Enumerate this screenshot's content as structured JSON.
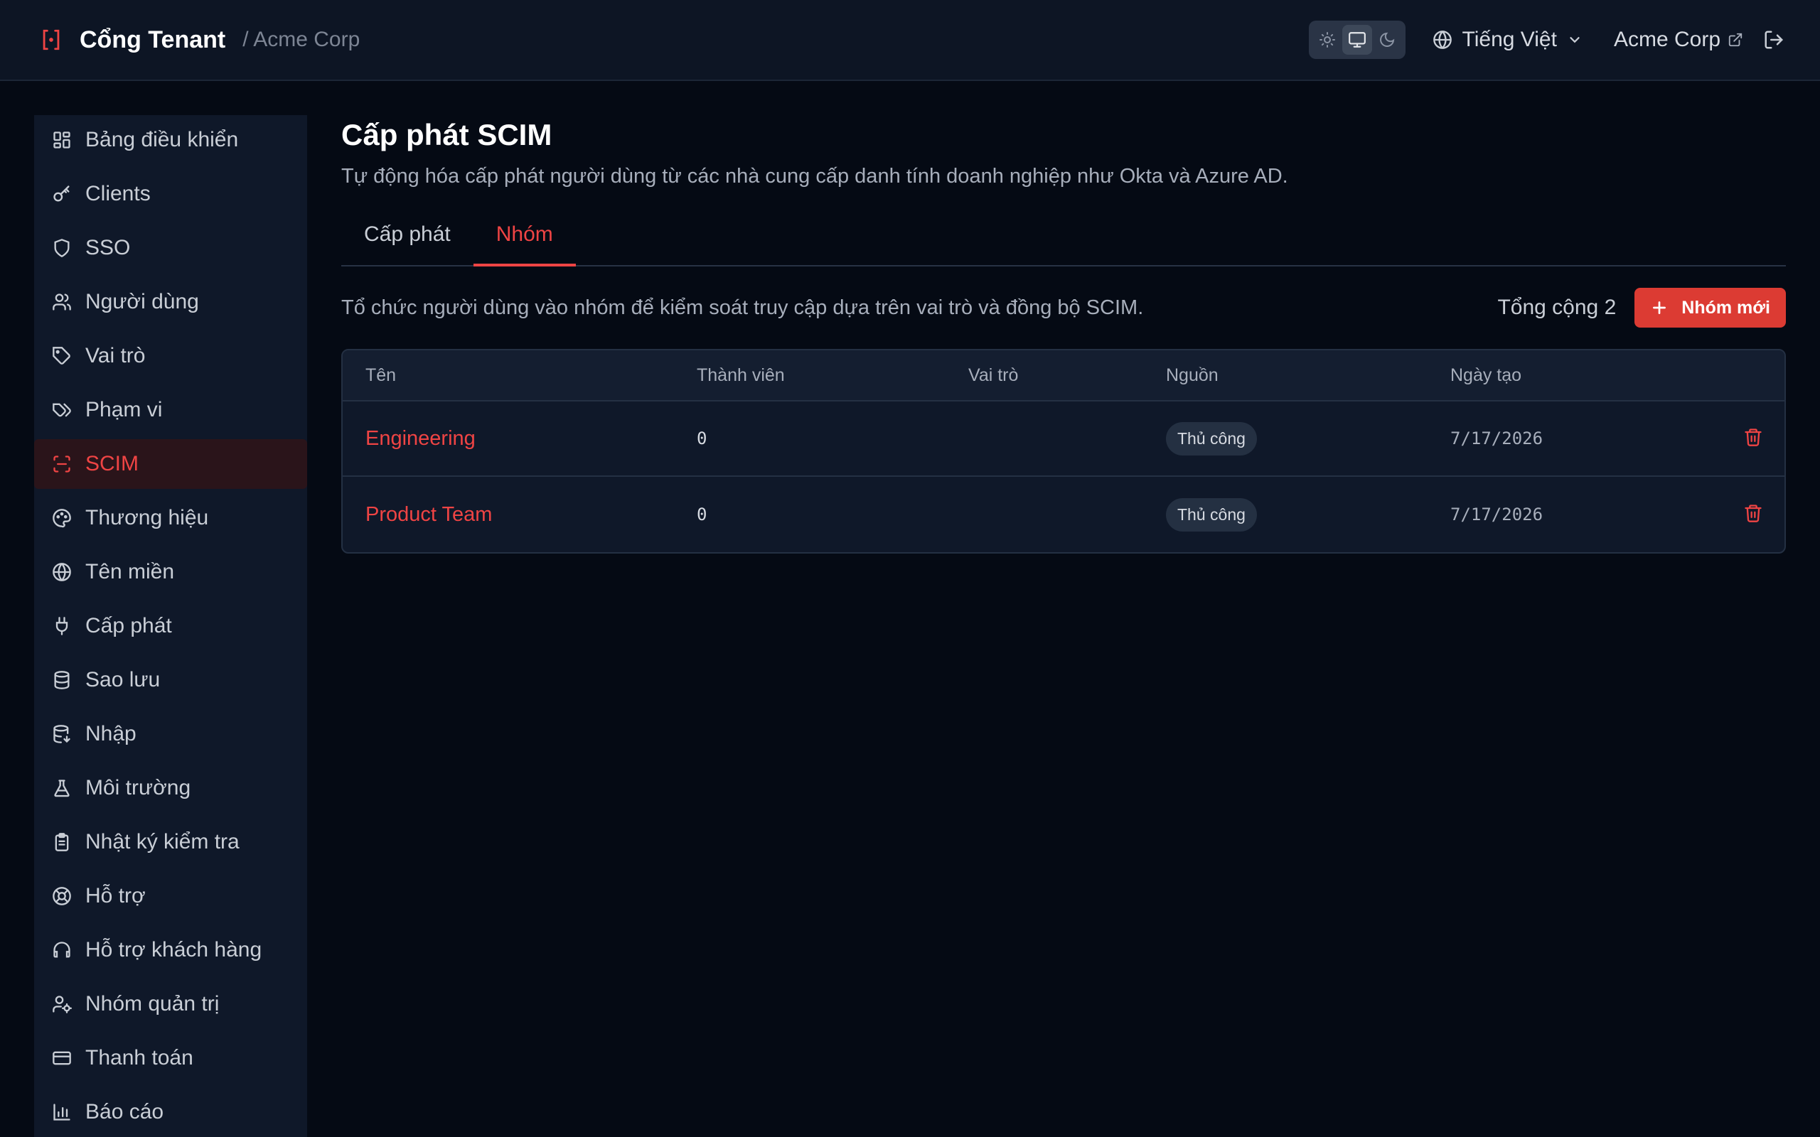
{
  "header": {
    "brand_name": "Cổng Tenant",
    "breadcrumb_org": "/ Acme Corp",
    "language": "Tiếng Việt",
    "org_link": "Acme Corp"
  },
  "sidebar": {
    "items": [
      {
        "label": "Bảng điều khiển",
        "icon": "dashboard-icon"
      },
      {
        "label": "Clients",
        "icon": "key-icon"
      },
      {
        "label": "SSO",
        "icon": "shield-icon"
      },
      {
        "label": "Người dùng",
        "icon": "users-icon"
      },
      {
        "label": "Vai trò",
        "icon": "tag-icon"
      },
      {
        "label": "Phạm vi",
        "icon": "tags-icon"
      },
      {
        "label": "SCIM",
        "icon": "scan-icon"
      },
      {
        "label": "Thương hiệu",
        "icon": "palette-icon"
      },
      {
        "label": "Tên miền",
        "icon": "globe-icon"
      },
      {
        "label": "Cấp phát",
        "icon": "plug-icon"
      },
      {
        "label": "Sao lưu",
        "icon": "database-icon"
      },
      {
        "label": "Nhập",
        "icon": "database-import-icon"
      },
      {
        "label": "Môi trường",
        "icon": "flask-icon"
      },
      {
        "label": "Nhật ký kiểm tra",
        "icon": "clipboard-icon"
      },
      {
        "label": "Hỗ trợ",
        "icon": "lifebuoy-icon"
      },
      {
        "label": "Hỗ trợ khách hàng",
        "icon": "headset-icon"
      },
      {
        "label": "Nhóm quản trị",
        "icon": "user-cog-icon"
      },
      {
        "label": "Thanh toán",
        "icon": "credit-card-icon"
      },
      {
        "label": "Báo cáo",
        "icon": "bar-chart-icon"
      }
    ],
    "active_index": 6
  },
  "main": {
    "title": "Cấp phát SCIM",
    "description": "Tự động hóa cấp phát người dùng từ các nhà cung cấp danh tính doanh nghiệp như Okta và Azure AD.",
    "tabs": [
      {
        "label": "Cấp phát"
      },
      {
        "label": "Nhóm"
      }
    ],
    "active_tab": 1,
    "groups_description": "Tổ chức người dùng vào nhóm để kiểm soát truy cập dựa trên vai trò và đồng bộ SCIM.",
    "total_label": "Tổng cộng 2",
    "new_group_label": "Nhóm mới",
    "table": {
      "columns": [
        "Tên",
        "Thành viên",
        "Vai trò",
        "Nguồn",
        "Ngày tạo"
      ],
      "rows": [
        {
          "name": "Engineering",
          "members": "0",
          "roles": "",
          "source": "Thủ công",
          "created": "7/17/2026"
        },
        {
          "name": "Product Team",
          "members": "0",
          "roles": "",
          "source": "Thủ công",
          "created": "7/17/2026"
        }
      ]
    }
  },
  "colors": {
    "accent": "#ef4444",
    "background": "#050a14",
    "panel": "#0f1829"
  }
}
